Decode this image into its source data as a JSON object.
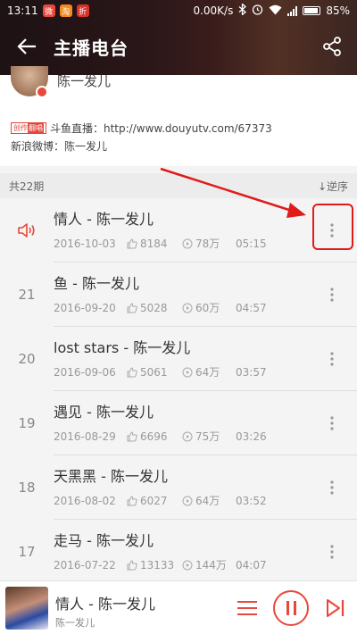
{
  "status": {
    "time": "13:11",
    "app_icons": [
      "微",
      "淘",
      "折"
    ],
    "net_speed": "0.00K/s",
    "battery": "85%"
  },
  "header": {
    "title": "主播电台"
  },
  "host": {
    "name": "陈一发儿",
    "tag_left": "创作",
    "tag_right": "翻唱",
    "line1": "斗鱼直播：http://www.douyutv.com/67373",
    "line2": "新浪微博：陈一发儿"
  },
  "episodes": {
    "count_label": "共22期",
    "sort_label": "↓逆序"
  },
  "items": [
    {
      "num": "",
      "title": "情人 - 陈一发儿",
      "date": "2016-10-03",
      "likes": "8184",
      "plays": "78万",
      "duration": "05:15",
      "playing": true
    },
    {
      "num": "21",
      "title": "鱼 - 陈一发儿",
      "date": "2016-09-20",
      "likes": "5028",
      "plays": "60万",
      "duration": "04:57"
    },
    {
      "num": "20",
      "title": "lost stars - 陈一发儿",
      "date": "2016-09-06",
      "likes": "5061",
      "plays": "64万",
      "duration": "03:57"
    },
    {
      "num": "19",
      "title": "遇见 - 陈一发儿",
      "date": "2016-08-29",
      "likes": "6696",
      "plays": "75万",
      "duration": "03:26"
    },
    {
      "num": "18",
      "title": "天黑黑 - 陈一发儿",
      "date": "2016-08-02",
      "likes": "6027",
      "plays": "64万",
      "duration": "03:52"
    },
    {
      "num": "17",
      "title": "走马 - 陈一发儿",
      "date": "2016-07-22",
      "likes": "13133",
      "plays": "144万",
      "duration": "04:07"
    }
  ],
  "player": {
    "title": "情人 - 陈一发儿",
    "artist": "陈一发儿"
  },
  "colors": {
    "accent": "#e8483b",
    "annotation": "#e01b1b"
  }
}
